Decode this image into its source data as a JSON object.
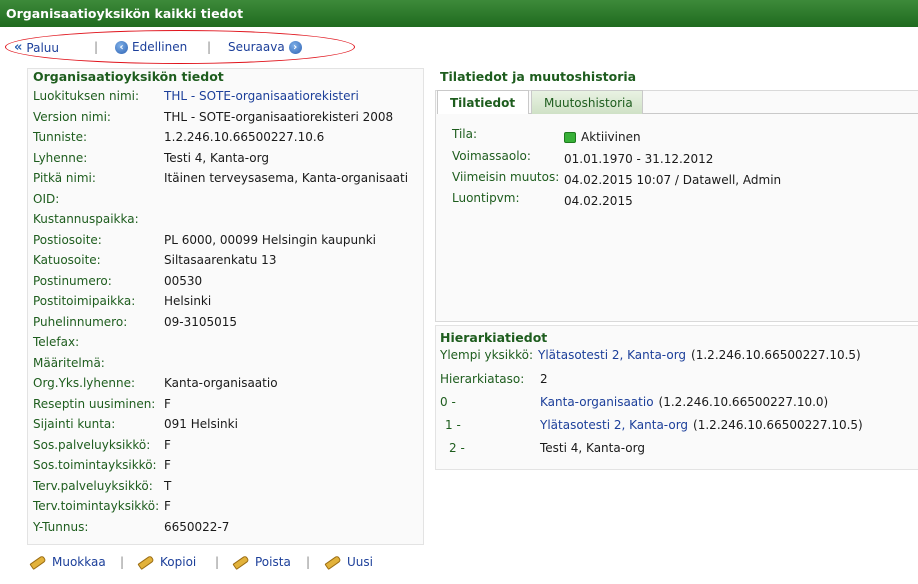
{
  "window": {
    "title": "Organisaatioyksikön kaikki tiedot"
  },
  "nav": {
    "back_label": "Paluu",
    "prev_label": "Edellinen",
    "next_label": "Seuraava",
    "separator": "|"
  },
  "info": {
    "title": "Organisaatioyksikön tiedot",
    "rows": [
      {
        "label": "Luokituksen nimi:",
        "value": "THL - SOTE-organisaatiorekisteri"
      },
      {
        "label": "Version nimi:",
        "value": "THL - SOTE-organisaatiorekisteri 2008"
      },
      {
        "label": "Tunniste:",
        "value": "1.2.246.10.66500227.10.6"
      },
      {
        "label": "Lyhenne:",
        "value": "Testi 4, Kanta-org"
      },
      {
        "label": "Pitkä nimi:",
        "value": "Itäinen terveysasema, Kanta-organisaati"
      },
      {
        "label": "OID:",
        "value": ""
      },
      {
        "label": "Kustannuspaikka:",
        "value": ""
      },
      {
        "label": "Postiosoite:",
        "value": "PL 6000, 00099 Helsingin kaupunki"
      },
      {
        "label": "Katuosoite:",
        "value": "Siltasaarenkatu 13"
      },
      {
        "label": "Postinumero:",
        "value": "00530"
      },
      {
        "label": "Postitoimipaikka:",
        "value": "Helsinki"
      },
      {
        "label": "Puhelinnumero:",
        "value": "09-3105015"
      },
      {
        "label": "Telefax:",
        "value": ""
      },
      {
        "label": "Määritelmä:",
        "value": ""
      },
      {
        "label": "Org.Yks.lyhenne:",
        "value": "Kanta-organisaatio"
      },
      {
        "label": "Reseptin uusiminen:",
        "value": "F"
      },
      {
        "label": "Sijainti kunta:",
        "value": "091 Helsinki"
      },
      {
        "label": "Sos.palveluyksikkö:",
        "value": "F"
      },
      {
        "label": "Sos.toimintayksikkö:",
        "value": "F"
      },
      {
        "label": "Terv.palveluyksikkö:",
        "value": "T"
      },
      {
        "label": "Terv.toimintayksikkö:",
        "value": "F"
      },
      {
        "label": "Y-Tunnus:",
        "value": "6650022-7"
      }
    ]
  },
  "status_section": {
    "title": "Tilatiedot ja muutoshistoria",
    "tabs": [
      "Tilatiedot",
      "Muutoshistoria"
    ],
    "rows": [
      {
        "label": "Tila:",
        "value": "Aktiivinen"
      },
      {
        "label": "Voimassaolo:",
        "value": "01.01.1970 - 31.12.2012"
      },
      {
        "label": "Viimeisin muutos:",
        "value": "04.02.2015 10:07 / Datawell, Admin"
      },
      {
        "label": "Luontipvm:",
        "value": "04.02.2015"
      }
    ],
    "status_color": "#38b038"
  },
  "hierarchy": {
    "title": "Hierarkiatiedot",
    "parent_label": "Ylempi yksikkö:",
    "parent_link": "Ylätasotesti 2, Kanta-org",
    "parent_oid": "(1.2.246.10.66500227.10.5)",
    "level_label": "Hierarkiataso:",
    "level_value": "2",
    "levels": [
      {
        "level": "0 -",
        "name": "Kanta-organisaatio",
        "oid": "(1.2.246.10.66500227.10.0)"
      },
      {
        "level": "1 -",
        "name": "Ylätasotesti 2, Kanta-org",
        "oid": "(1.2.246.10.66500227.10.5)"
      },
      {
        "level": "2 -",
        "name": "Testi 4, Kanta-org",
        "oid": ""
      }
    ]
  },
  "actions": {
    "edit": "Muokkaa",
    "copy": "Kopioi",
    "delete": "Poista",
    "new": "Uusi"
  },
  "colors": {
    "title_bar": "#2b7a2b",
    "label_green": "#1e5d1e",
    "link_blue": "#1c3f9a",
    "highlight_ellipse": "#e0141c"
  }
}
